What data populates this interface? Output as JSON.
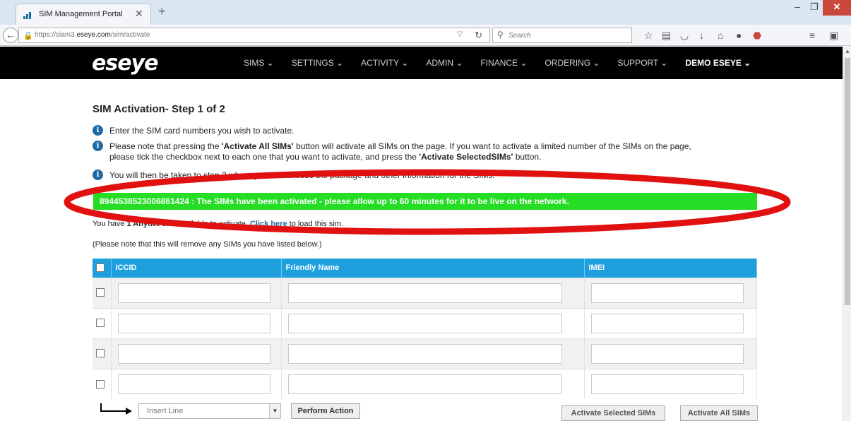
{
  "browser": {
    "tab_title": "SIM Management Portal",
    "tab_close_glyph": "✕",
    "new_tab_glyph": "+",
    "url_prefix": "https://siam3.",
    "url_domain": "eseye.com",
    "url_path": "/sim/activate",
    "search_placeholder": "Search",
    "window_controls": [
      "–",
      "❐",
      "✕"
    ],
    "toolbar_icons": [
      "star-icon",
      "reading-list-icon",
      "pocket-icon",
      "download-icon",
      "home-icon",
      "chat-icon",
      "adblock-icon",
      "menu-icon",
      "extension-icon"
    ]
  },
  "header": {
    "logo": "eseye",
    "menu": [
      "SIMS ⌄",
      "SETTINGS ⌄",
      "ACTIVITY ⌄",
      "ADMIN ⌄",
      "FINANCE ⌄",
      "ORDERING ⌄",
      "SUPPORT ⌄"
    ],
    "user": "DEMO ESEYE ⌄"
  },
  "page": {
    "heading": "SIM Activation- Step 1 of 2",
    "info1": "Enter the SIM card numbers you wish to activate.",
    "info2_a": "Please note that pressing the ",
    "info2_b": "'Activate All SIMs'",
    "info2_c": " button will activate all SIMs on the page. If you want to activate a limited number of the SIMs on the page,",
    "info2_line2_a": "please tick the checkbox next to each one that you want to activate, and press the ",
    "info2_line2_b": "'Activate SelectedSIMs'",
    "info2_line2_c": " button.",
    "info3": "You will then be taken to step 2 where you can choose the package and other information for the SIMs.",
    "success": "8944538523006861424 : The SIMs have been activated - please allow up to 60 minutes for it to be live on the network.",
    "available_a": "You have ",
    "available_b": "1 Anynet",
    "available_c": " SIM available to activate. ",
    "available_link": "Click here",
    "available_d": " to load this sim.",
    "remove_note": "(Please note that this will remove any SIMs you have listed below.)"
  },
  "table": {
    "headers": [
      "ICCID",
      "Friendly Name",
      "IMEI"
    ],
    "rows": [
      {
        "iccid": "",
        "friendly_name": "",
        "imei": ""
      },
      {
        "iccid": "",
        "friendly_name": "",
        "imei": ""
      },
      {
        "iccid": "",
        "friendly_name": "",
        "imei": ""
      },
      {
        "iccid": "",
        "friendly_name": "",
        "imei": ""
      }
    ]
  },
  "actions": {
    "select_value": "Insert Line",
    "perform": "Perform Action",
    "activate_selected": "Activate Selected SIMs",
    "activate_all": "Activate All SIMs"
  },
  "colors": {
    "table_header": "#1ea0df",
    "success_banner": "#25dd25",
    "annotation_ring": "#e11111",
    "info_icon": "#1f6aa5"
  }
}
